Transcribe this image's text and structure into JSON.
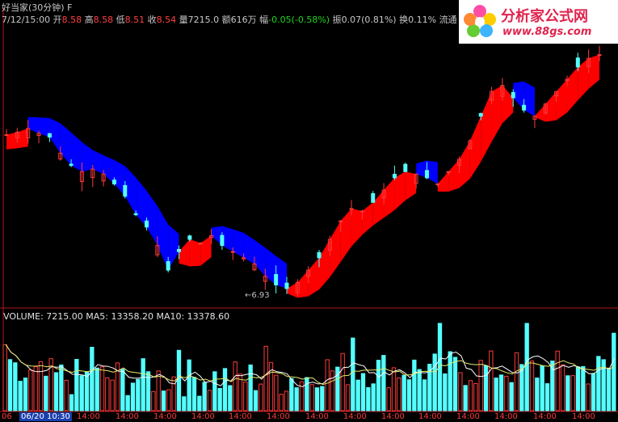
{
  "header": {
    "title": "好当家(30分钟) F",
    "datetime": "7/12/15:00",
    "open_label": "开",
    "open_value": "8.58",
    "high_label": "高",
    "high_value": "8.58",
    "low_label": "低",
    "low_value": "8.51",
    "close_label": "收",
    "close_value": "8.54",
    "volume_label": "量",
    "volume_value": "7215.0",
    "amount_label": "额",
    "amount_value": "616万",
    "change_label": "幅",
    "change_value": "-0.05(-0.58%)",
    "amplitude_label": "振",
    "amplitude_value": "0.07(0.81%)",
    "turnover_label": "换",
    "turnover_value": "0.11%",
    "float_label": "流通"
  },
  "price_chart": {
    "low_marker_label": "←6.93",
    "up_band_color": "#ff0000",
    "down_band_color": "#0000ff",
    "up_candle_color": "#ff3b3b",
    "down_candle_color": "#54ffff"
  },
  "volume_panel": {
    "info": "VOLUME: 7215.00  MA5: 13358.20  MA10: 13378.60",
    "ma5_color": "#ffffff",
    "ma10_color": "#e8e86a"
  },
  "x_axis": {
    "ticks": [
      "06",
      "06/20 10:30",
      "14:00",
      "14:00",
      "14:00",
      "14:00",
      "14:00",
      "14:00",
      "14:00",
      "14:00",
      "14:00",
      "14:00",
      "14:00",
      "14:00",
      "14:00",
      "14:00"
    ]
  },
  "watermark": {
    "title": "分析家公式网",
    "url": "www.88gs.com"
  },
  "chart_data": {
    "type": "candlestick",
    "low_price": 6.93,
    "close": [
      8.2,
      8.22,
      8.25,
      8.21,
      8.18,
      8.05,
      7.95,
      7.9,
      7.92,
      7.88,
      7.8,
      7.7,
      7.55,
      7.45,
      7.3,
      7.1,
      7.25,
      7.35,
      7.32,
      7.38,
      7.3,
      7.25,
      7.2,
      7.15,
      7.05,
      6.98,
      6.95,
      7.0,
      7.1,
      7.2,
      7.35,
      7.5,
      7.6,
      7.58,
      7.65,
      7.75,
      7.85,
      7.9,
      7.88,
      7.85,
      7.8,
      7.9,
      8.0,
      8.15,
      8.35,
      8.55,
      8.6,
      8.5,
      8.4,
      8.35,
      8.45,
      8.55,
      8.65,
      8.75,
      8.82,
      8.85
    ]
  }
}
